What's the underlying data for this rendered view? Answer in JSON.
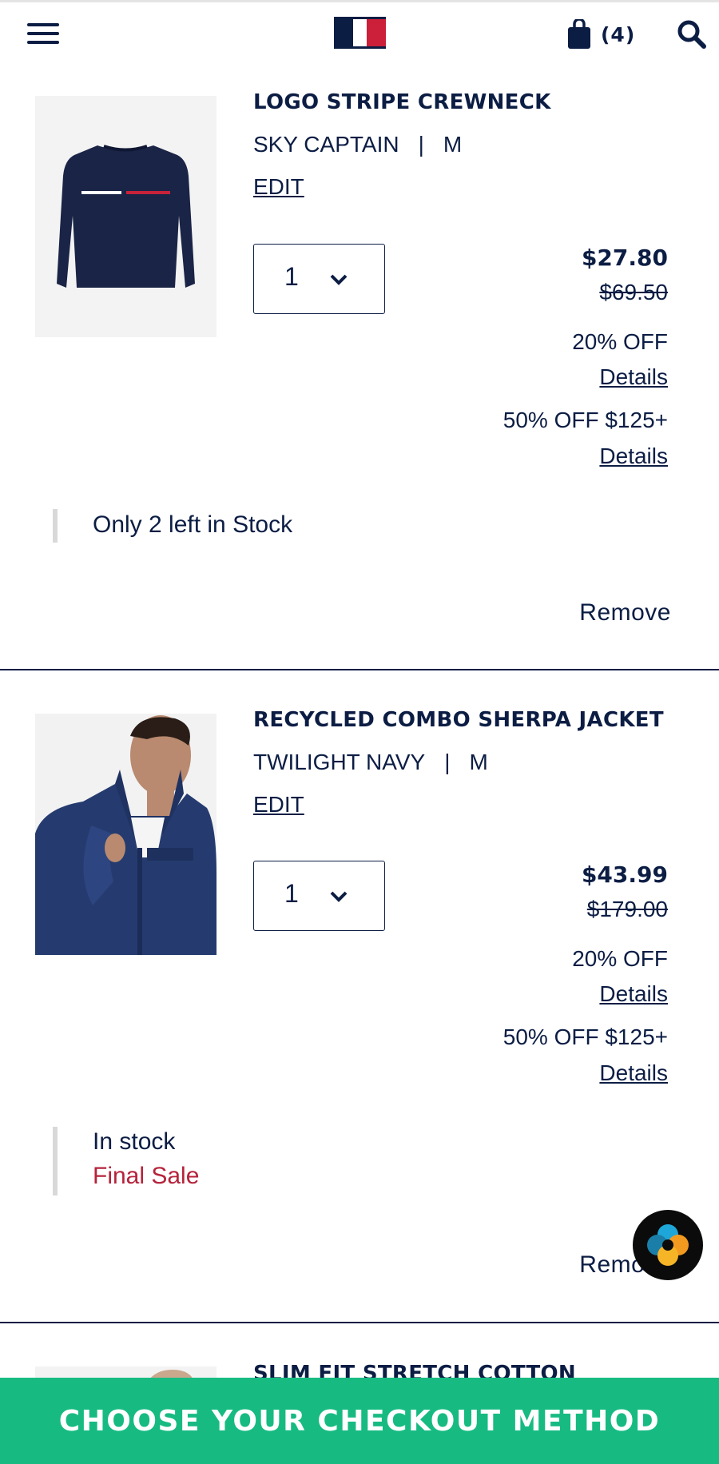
{
  "header": {
    "menu_icon": "hamburger-menu-icon",
    "logo": "tommy-hilfiger-flag-logo",
    "bag_icon": "shopping-bag-icon",
    "bag_count": "(4)",
    "search_icon": "search-icon"
  },
  "items": [
    {
      "title": "LOGO STRIPE CREWNECK",
      "color": "SKY CAPTAIN",
      "separator": "|",
      "size": "M",
      "edit_label": "EDIT",
      "quantity": "1",
      "price": "$27.80",
      "original_price": "$69.50",
      "promos": [
        {
          "label": "20% OFF",
          "details": "Details"
        },
        {
          "label": "50% OFF $125+",
          "details": "Details"
        }
      ],
      "stock": "Only 2 left in Stock",
      "remove_label": "Remove"
    },
    {
      "title": "RECYCLED COMBO SHERPA JACKET",
      "color": "TWILIGHT NAVY",
      "separator": "|",
      "size": "M",
      "edit_label": "EDIT",
      "quantity": "1",
      "price": "$43.99",
      "original_price": "$179.00",
      "promos": [
        {
          "label": "20% OFF",
          "details": "Details"
        },
        {
          "label": "50% OFF $125+",
          "details": "Details"
        }
      ],
      "stock": "In stock",
      "final_sale": "Final Sale",
      "remove_label": "Remove"
    },
    {
      "title": "SLIM FIT STRETCH COTTON"
    }
  ],
  "checkout": {
    "label": "CHOOSE YOUR CHECKOUT METHOD"
  },
  "colors": {
    "navy": "#0c1d44",
    "red": "#cc1f39",
    "final_sale": "#b5233b",
    "checkout_green": "#17bb82"
  }
}
